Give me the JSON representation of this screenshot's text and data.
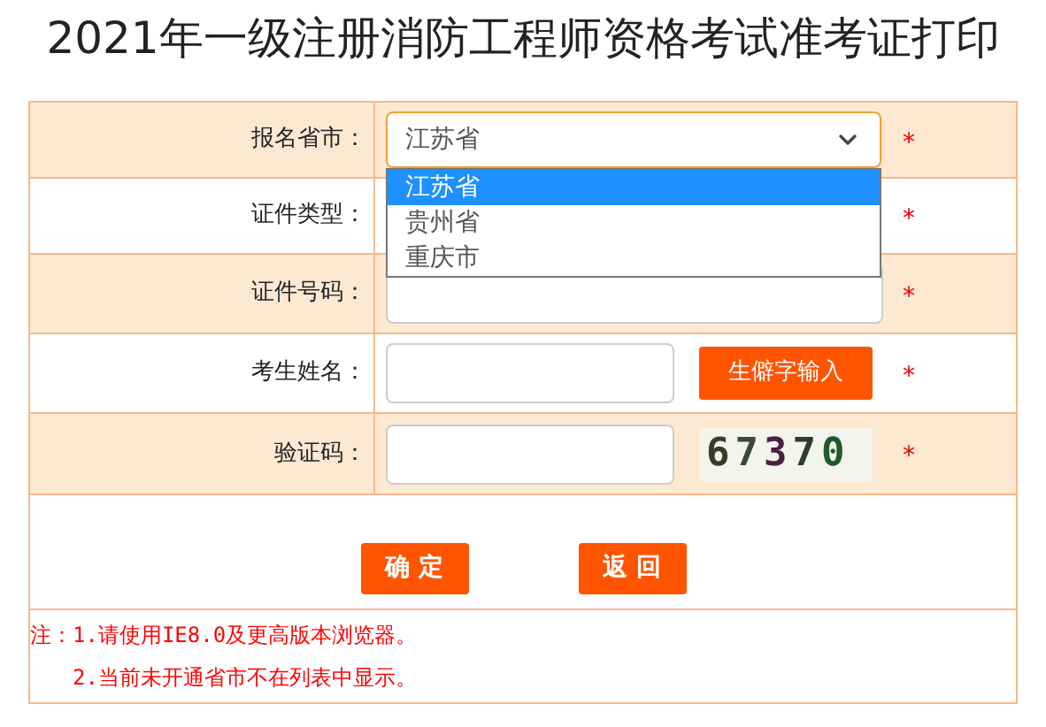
{
  "title": "2021年一级注册消防工程师资格考试准考证打印",
  "rows": [
    {
      "label": "报名省市：",
      "kind": "select",
      "value": "江苏省",
      "required": "*",
      "options": [
        {
          "label": "江苏省",
          "selected": true
        },
        {
          "label": "贵州省",
          "selected": false
        },
        {
          "label": "重庆市",
          "selected": false
        }
      ]
    },
    {
      "label": "证件类型：",
      "kind": "covered",
      "required": "*"
    },
    {
      "label": "证件号码：",
      "kind": "input",
      "required": "*"
    },
    {
      "label": "考生姓名：",
      "kind": "input_button",
      "button": "生僻字输入",
      "required": "*"
    },
    {
      "label": "验证码：",
      "kind": "captcha",
      "captcha": "67370",
      "required": "*"
    }
  ],
  "buttons": [
    "确 定",
    "返 回"
  ],
  "notes": [
    "注：1.请使用IE8.0及更高版本浏览器。",
    "2.当前未开通省市不在列表中显示。"
  ]
}
